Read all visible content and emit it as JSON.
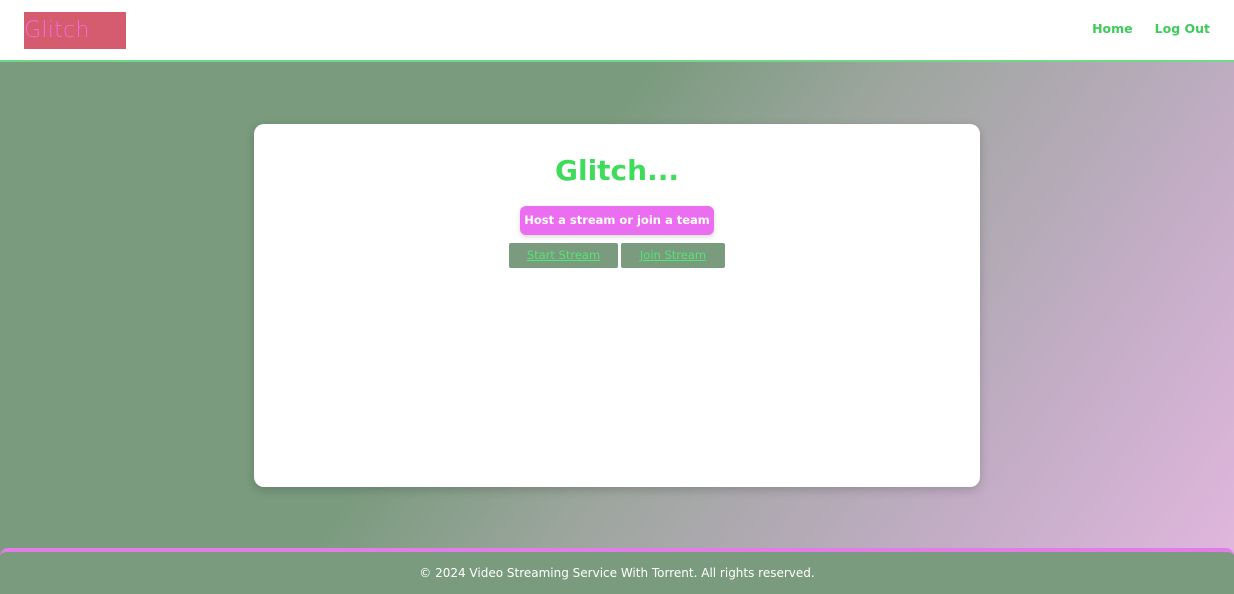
{
  "header": {
    "logo_text": "Glitch",
    "nav": {
      "home_label": "Home",
      "logout_label": "Log Out"
    }
  },
  "main": {
    "title": "Glitch...",
    "host_button_label": "Host a stream or join a team",
    "start_stream_label": "Start Stream",
    "join_stream_label": "Join Stream"
  },
  "footer": {
    "copyright": "© 2024 Video Streaming Service With Torrent. All rights reserved."
  },
  "colors": {
    "accent_green": "#3fdc5c",
    "accent_pink": "#ec6ef0",
    "sage": "#7a9b7e",
    "logo_bg": "#d45c6e"
  }
}
